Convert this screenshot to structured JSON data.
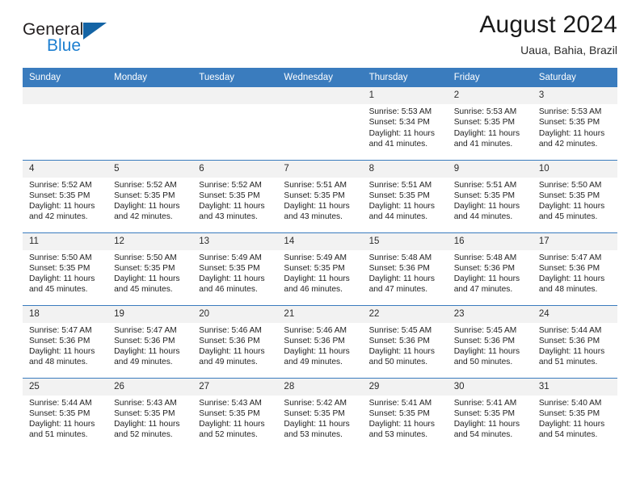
{
  "brand": {
    "line1": "General",
    "line2": "Blue",
    "triangle_color": "#1464a5",
    "accent_color": "#1d7fd0"
  },
  "header": {
    "title": "August 2024",
    "subtitle": "Uaua, Bahia, Brazil"
  },
  "theme": {
    "header_bg": "#3a7cbe",
    "daynum_bg": "#f2f2f2",
    "grid_line": "#3a7cbe",
    "text": "#1f1f1f"
  },
  "weekday_headers": [
    "Sunday",
    "Monday",
    "Tuesday",
    "Wednesday",
    "Thursday",
    "Friday",
    "Saturday"
  ],
  "labels": {
    "sunrise_prefix": "Sunrise: ",
    "sunset_prefix": "Sunset: ",
    "daylight_prefix": "Daylight: "
  },
  "weeks": [
    [
      {
        "day": "",
        "empty": true,
        "sunrise": "",
        "sunset": "",
        "daylight_line1": "",
        "daylight_line2": ""
      },
      {
        "day": "",
        "empty": true,
        "sunrise": "",
        "sunset": "",
        "daylight_line1": "",
        "daylight_line2": ""
      },
      {
        "day": "",
        "empty": true,
        "sunrise": "",
        "sunset": "",
        "daylight_line1": "",
        "daylight_line2": ""
      },
      {
        "day": "",
        "empty": true,
        "sunrise": "",
        "sunset": "",
        "daylight_line1": "",
        "daylight_line2": ""
      },
      {
        "day": "1",
        "empty": false,
        "sunrise": "Sunrise: 5:53 AM",
        "sunset": "Sunset: 5:34 PM",
        "daylight_line1": "Daylight: 11 hours",
        "daylight_line2": "and 41 minutes."
      },
      {
        "day": "2",
        "empty": false,
        "sunrise": "Sunrise: 5:53 AM",
        "sunset": "Sunset: 5:35 PM",
        "daylight_line1": "Daylight: 11 hours",
        "daylight_line2": "and 41 minutes."
      },
      {
        "day": "3",
        "empty": false,
        "sunrise": "Sunrise: 5:53 AM",
        "sunset": "Sunset: 5:35 PM",
        "daylight_line1": "Daylight: 11 hours",
        "daylight_line2": "and 42 minutes."
      }
    ],
    [
      {
        "day": "4",
        "empty": false,
        "sunrise": "Sunrise: 5:52 AM",
        "sunset": "Sunset: 5:35 PM",
        "daylight_line1": "Daylight: 11 hours",
        "daylight_line2": "and 42 minutes."
      },
      {
        "day": "5",
        "empty": false,
        "sunrise": "Sunrise: 5:52 AM",
        "sunset": "Sunset: 5:35 PM",
        "daylight_line1": "Daylight: 11 hours",
        "daylight_line2": "and 42 minutes."
      },
      {
        "day": "6",
        "empty": false,
        "sunrise": "Sunrise: 5:52 AM",
        "sunset": "Sunset: 5:35 PM",
        "daylight_line1": "Daylight: 11 hours",
        "daylight_line2": "and 43 minutes."
      },
      {
        "day": "7",
        "empty": false,
        "sunrise": "Sunrise: 5:51 AM",
        "sunset": "Sunset: 5:35 PM",
        "daylight_line1": "Daylight: 11 hours",
        "daylight_line2": "and 43 minutes."
      },
      {
        "day": "8",
        "empty": false,
        "sunrise": "Sunrise: 5:51 AM",
        "sunset": "Sunset: 5:35 PM",
        "daylight_line1": "Daylight: 11 hours",
        "daylight_line2": "and 44 minutes."
      },
      {
        "day": "9",
        "empty": false,
        "sunrise": "Sunrise: 5:51 AM",
        "sunset": "Sunset: 5:35 PM",
        "daylight_line1": "Daylight: 11 hours",
        "daylight_line2": "and 44 minutes."
      },
      {
        "day": "10",
        "empty": false,
        "sunrise": "Sunrise: 5:50 AM",
        "sunset": "Sunset: 5:35 PM",
        "daylight_line1": "Daylight: 11 hours",
        "daylight_line2": "and 45 minutes."
      }
    ],
    [
      {
        "day": "11",
        "empty": false,
        "sunrise": "Sunrise: 5:50 AM",
        "sunset": "Sunset: 5:35 PM",
        "daylight_line1": "Daylight: 11 hours",
        "daylight_line2": "and 45 minutes."
      },
      {
        "day": "12",
        "empty": false,
        "sunrise": "Sunrise: 5:50 AM",
        "sunset": "Sunset: 5:35 PM",
        "daylight_line1": "Daylight: 11 hours",
        "daylight_line2": "and 45 minutes."
      },
      {
        "day": "13",
        "empty": false,
        "sunrise": "Sunrise: 5:49 AM",
        "sunset": "Sunset: 5:35 PM",
        "daylight_line1": "Daylight: 11 hours",
        "daylight_line2": "and 46 minutes."
      },
      {
        "day": "14",
        "empty": false,
        "sunrise": "Sunrise: 5:49 AM",
        "sunset": "Sunset: 5:35 PM",
        "daylight_line1": "Daylight: 11 hours",
        "daylight_line2": "and 46 minutes."
      },
      {
        "day": "15",
        "empty": false,
        "sunrise": "Sunrise: 5:48 AM",
        "sunset": "Sunset: 5:36 PM",
        "daylight_line1": "Daylight: 11 hours",
        "daylight_line2": "and 47 minutes."
      },
      {
        "day": "16",
        "empty": false,
        "sunrise": "Sunrise: 5:48 AM",
        "sunset": "Sunset: 5:36 PM",
        "daylight_line1": "Daylight: 11 hours",
        "daylight_line2": "and 47 minutes."
      },
      {
        "day": "17",
        "empty": false,
        "sunrise": "Sunrise: 5:47 AM",
        "sunset": "Sunset: 5:36 PM",
        "daylight_line1": "Daylight: 11 hours",
        "daylight_line2": "and 48 minutes."
      }
    ],
    [
      {
        "day": "18",
        "empty": false,
        "sunrise": "Sunrise: 5:47 AM",
        "sunset": "Sunset: 5:36 PM",
        "daylight_line1": "Daylight: 11 hours",
        "daylight_line2": "and 48 minutes."
      },
      {
        "day": "19",
        "empty": false,
        "sunrise": "Sunrise: 5:47 AM",
        "sunset": "Sunset: 5:36 PM",
        "daylight_line1": "Daylight: 11 hours",
        "daylight_line2": "and 49 minutes."
      },
      {
        "day": "20",
        "empty": false,
        "sunrise": "Sunrise: 5:46 AM",
        "sunset": "Sunset: 5:36 PM",
        "daylight_line1": "Daylight: 11 hours",
        "daylight_line2": "and 49 minutes."
      },
      {
        "day": "21",
        "empty": false,
        "sunrise": "Sunrise: 5:46 AM",
        "sunset": "Sunset: 5:36 PM",
        "daylight_line1": "Daylight: 11 hours",
        "daylight_line2": "and 49 minutes."
      },
      {
        "day": "22",
        "empty": false,
        "sunrise": "Sunrise: 5:45 AM",
        "sunset": "Sunset: 5:36 PM",
        "daylight_line1": "Daylight: 11 hours",
        "daylight_line2": "and 50 minutes."
      },
      {
        "day": "23",
        "empty": false,
        "sunrise": "Sunrise: 5:45 AM",
        "sunset": "Sunset: 5:36 PM",
        "daylight_line1": "Daylight: 11 hours",
        "daylight_line2": "and 50 minutes."
      },
      {
        "day": "24",
        "empty": false,
        "sunrise": "Sunrise: 5:44 AM",
        "sunset": "Sunset: 5:36 PM",
        "daylight_line1": "Daylight: 11 hours",
        "daylight_line2": "and 51 minutes."
      }
    ],
    [
      {
        "day": "25",
        "empty": false,
        "sunrise": "Sunrise: 5:44 AM",
        "sunset": "Sunset: 5:35 PM",
        "daylight_line1": "Daylight: 11 hours",
        "daylight_line2": "and 51 minutes."
      },
      {
        "day": "26",
        "empty": false,
        "sunrise": "Sunrise: 5:43 AM",
        "sunset": "Sunset: 5:35 PM",
        "daylight_line1": "Daylight: 11 hours",
        "daylight_line2": "and 52 minutes."
      },
      {
        "day": "27",
        "empty": false,
        "sunrise": "Sunrise: 5:43 AM",
        "sunset": "Sunset: 5:35 PM",
        "daylight_line1": "Daylight: 11 hours",
        "daylight_line2": "and 52 minutes."
      },
      {
        "day": "28",
        "empty": false,
        "sunrise": "Sunrise: 5:42 AM",
        "sunset": "Sunset: 5:35 PM",
        "daylight_line1": "Daylight: 11 hours",
        "daylight_line2": "and 53 minutes."
      },
      {
        "day": "29",
        "empty": false,
        "sunrise": "Sunrise: 5:41 AM",
        "sunset": "Sunset: 5:35 PM",
        "daylight_line1": "Daylight: 11 hours",
        "daylight_line2": "and 53 minutes."
      },
      {
        "day": "30",
        "empty": false,
        "sunrise": "Sunrise: 5:41 AM",
        "sunset": "Sunset: 5:35 PM",
        "daylight_line1": "Daylight: 11 hours",
        "daylight_line2": "and 54 minutes."
      },
      {
        "day": "31",
        "empty": false,
        "sunrise": "Sunrise: 5:40 AM",
        "sunset": "Sunset: 5:35 PM",
        "daylight_line1": "Daylight: 11 hours",
        "daylight_line2": "and 54 minutes."
      }
    ]
  ]
}
